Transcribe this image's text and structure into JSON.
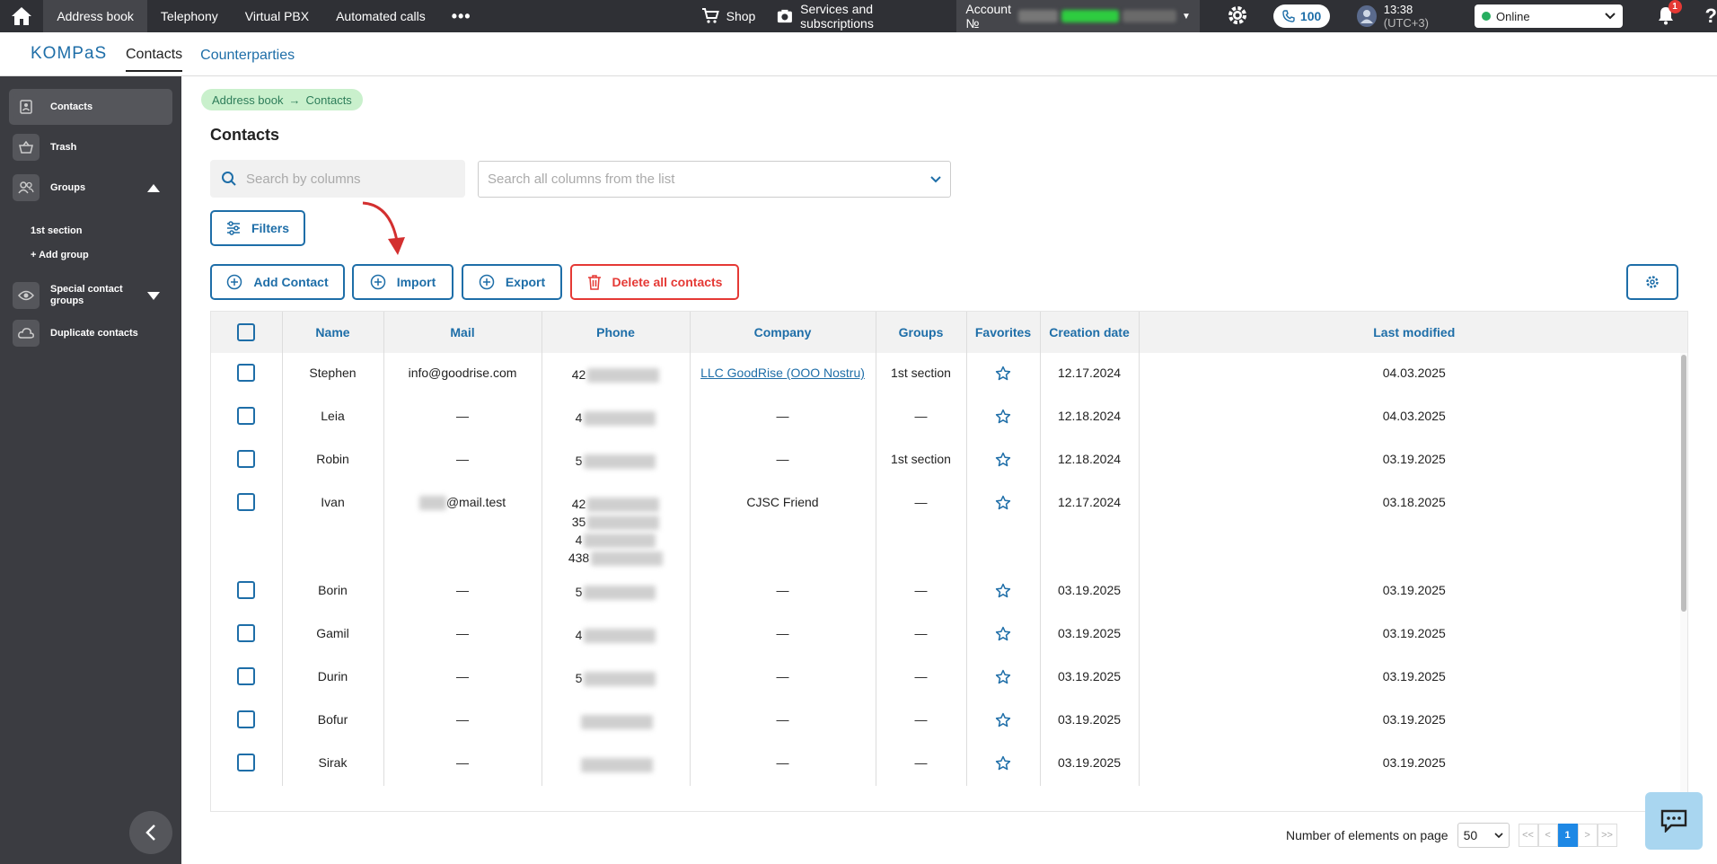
{
  "topbar": {
    "nav": [
      "Address book",
      "Telephony",
      "Virtual PBX",
      "Automated calls"
    ],
    "more": "•••",
    "shop": "Shop",
    "services": "Services and subscriptions",
    "account_label": "Account №",
    "calls_count": "100",
    "time": "13:38",
    "timezone": "(UTC+3)",
    "status": "Online",
    "notifications": "1",
    "help": "?"
  },
  "subheader": {
    "logo": "KOMPaS",
    "tabs": [
      "Contacts",
      "Counterparties"
    ]
  },
  "sidebar": {
    "items": [
      "Contacts",
      "Trash",
      "Groups"
    ],
    "groups": [
      "1st section",
      "+ Add group"
    ],
    "special": "Special contact groups",
    "duplicates": "Duplicate contacts"
  },
  "breadcrumb": {
    "root": "Address book",
    "current": "Contacts"
  },
  "page_title": "Contacts",
  "search": {
    "placeholder": "Search by columns"
  },
  "columns_select": {
    "placeholder": "Search all columns from the list"
  },
  "buttons": {
    "filters": "Filters",
    "add": "Add Contact",
    "import": "Import",
    "export": "Export",
    "delete_all": "Delete all contacts"
  },
  "table": {
    "headers": [
      "Name",
      "Mail",
      "Phone",
      "Company",
      "Groups",
      "Favorites",
      "Creation date",
      "Last modified"
    ],
    "rows": [
      {
        "name": "Stephen",
        "mail": "info@goodrise.com",
        "phone": "42",
        "company": "LLC GoodRise (OOO Nostru)",
        "company_link": true,
        "groups": "1st section",
        "created": "12.17.2024",
        "modified": "04.03.2025"
      },
      {
        "name": "Leia",
        "mail": "—",
        "phone": "4",
        "company": "—",
        "company_link": false,
        "groups": "—",
        "created": "12.18.2024",
        "modified": "04.03.2025"
      },
      {
        "name": "Robin",
        "mail": "—",
        "phone": "5",
        "company": "—",
        "company_link": false,
        "groups": "1st section",
        "created": "12.18.2024",
        "modified": "03.19.2025"
      },
      {
        "name": "Ivan",
        "mail": "@mail.test",
        "phone": "42",
        "phone_extra": [
          "35",
          "4",
          "438"
        ],
        "company": "CJSC Friend",
        "company_link": false,
        "groups": "—",
        "created": "12.17.2024",
        "modified": "03.18.2025"
      },
      {
        "name": "Borin",
        "mail": "—",
        "phone": "5",
        "company": "—",
        "company_link": false,
        "groups": "—",
        "created": "03.19.2025",
        "modified": "03.19.2025"
      },
      {
        "name": "Gamil",
        "mail": "—",
        "phone": "4",
        "company": "—",
        "company_link": false,
        "groups": "—",
        "created": "03.19.2025",
        "modified": "03.19.2025"
      },
      {
        "name": "Durin",
        "mail": "—",
        "phone": "5",
        "company": "—",
        "company_link": false,
        "groups": "—",
        "created": "03.19.2025",
        "modified": "03.19.2025"
      },
      {
        "name": "Bofur",
        "mail": "—",
        "phone": "",
        "company": "—",
        "company_link": false,
        "groups": "—",
        "created": "03.19.2025",
        "modified": "03.19.2025"
      },
      {
        "name": "Sirak",
        "mail": "—",
        "phone": "",
        "company": "—",
        "company_link": false,
        "groups": "—",
        "created": "03.19.2025",
        "modified": "03.19.2025"
      }
    ]
  },
  "pagination": {
    "label": "Number of elements on page",
    "page_size": "50",
    "first": "<<",
    "prev": "<",
    "current": "1",
    "next": ">",
    "last": ">>"
  },
  "colors": {
    "accent": "#1e6ea8",
    "danger": "#e53935",
    "topbar": "#2f3035",
    "sidebar": "#3b3c41"
  }
}
